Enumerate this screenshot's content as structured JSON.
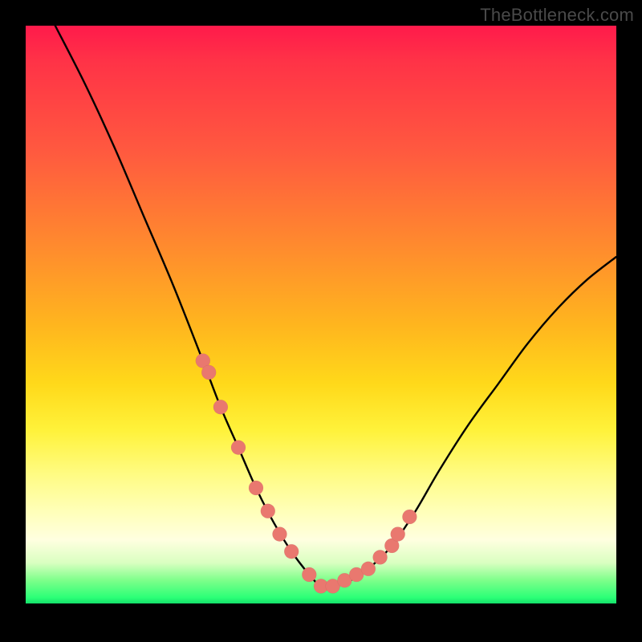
{
  "watermark": "TheBottleneck.com",
  "chart_data": {
    "type": "line",
    "title": "",
    "xlabel": "",
    "ylabel": "",
    "xlim": [
      0,
      100
    ],
    "ylim": [
      0,
      100
    ],
    "grid": false,
    "legend": false,
    "series": [
      {
        "name": "bottleneck-curve",
        "x": [
          5,
          10,
          15,
          20,
          25,
          30,
          33,
          36,
          39,
          42,
          45,
          48,
          50,
          52,
          55,
          58,
          62,
          66,
          70,
          75,
          80,
          85,
          90,
          95,
          100
        ],
        "values": [
          100,
          90,
          79,
          67,
          55,
          42,
          34,
          27,
          20,
          14,
          9,
          5,
          3,
          3,
          4,
          6,
          10,
          16,
          23,
          31,
          38,
          45,
          51,
          56,
          60
        ]
      }
    ],
    "beads": {
      "name": "highlighted-points",
      "x": [
        30,
        31,
        33,
        36,
        39,
        41,
        43,
        45,
        48,
        50,
        52,
        54,
        56,
        58,
        60,
        62,
        63,
        65
      ],
      "values": [
        42,
        40,
        34,
        27,
        20,
        16,
        12,
        9,
        5,
        3,
        3,
        4,
        5,
        6,
        8,
        10,
        12,
        15
      ]
    },
    "background_gradient": {
      "top": "#ff1a4b",
      "mid": "#fff23a",
      "bottom": "#14e06a"
    }
  }
}
